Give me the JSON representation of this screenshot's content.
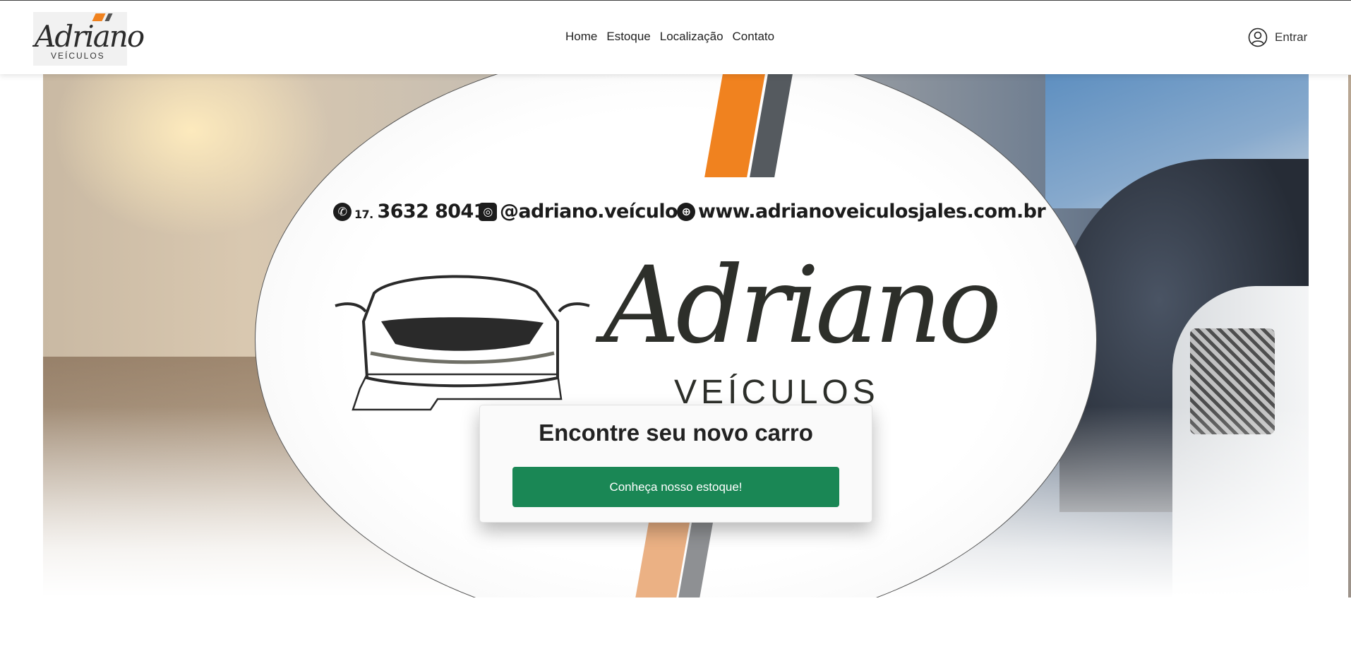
{
  "header": {
    "logo": {
      "script": "Adriano",
      "sub": "VEÍCULOS"
    },
    "nav": [
      {
        "label": "Home"
      },
      {
        "label": "Estoque"
      },
      {
        "label": "Localização"
      },
      {
        "label": "Contato"
      }
    ],
    "login": {
      "label": "Entrar",
      "icon": "user-circle-icon"
    }
  },
  "hero": {
    "banner": {
      "phone_prefix": "17.",
      "phone": "3632 8041",
      "instagram": "@adriano.veículos",
      "website": "www.adrianoveiculosjales.com.br",
      "brand_script": "Adriano",
      "brand_sub": "VEÍCULOS"
    },
    "card": {
      "title": "Encontre seu novo carro",
      "button": "Conheça nosso estoque!"
    }
  },
  "colors": {
    "accent_orange": "#f0821f",
    "button_green": "#1a8755"
  }
}
